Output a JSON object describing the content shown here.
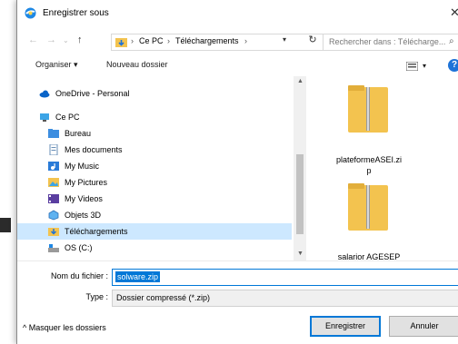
{
  "window": {
    "title": "Enregistrer sous"
  },
  "address": {
    "crumbs": [
      "Ce PC",
      "Téléchargements"
    ],
    "search_placeholder": "Rechercher dans : Télécharge..."
  },
  "toolbar": {
    "organize": "Organiser ▾",
    "new_folder": "Nouveau dossier"
  },
  "nav": {
    "items": [
      {
        "label": "OneDrive - Personal",
        "icon": "cloud-icon"
      },
      {
        "label": "Ce PC",
        "icon": "pc-icon"
      },
      {
        "label": "Bureau",
        "icon": "folder-icon"
      },
      {
        "label": "Mes documents",
        "icon": "documents-icon"
      },
      {
        "label": "My Music",
        "icon": "music-icon"
      },
      {
        "label": "My Pictures",
        "icon": "pictures-icon"
      },
      {
        "label": "My Videos",
        "icon": "videos-icon"
      },
      {
        "label": "Objets 3D",
        "icon": "objects3d-icon"
      },
      {
        "label": "Téléchargements",
        "icon": "downloads-icon",
        "selected": true
      },
      {
        "label": "OS (C:)",
        "icon": "drive-icon"
      }
    ]
  },
  "files": [
    {
      "name_line1": "plateformeASEI.zi",
      "name_line2": "p"
    },
    {
      "name_line1": "salarior AGESEP",
      "name_line2": ""
    }
  ],
  "form": {
    "filename_label": "Nom du fichier :",
    "filename_value": "solware.zip",
    "type_label": "Type :",
    "type_value": "Dossier compressé (*.zip)"
  },
  "footer": {
    "hide_folders": "^ Masquer les dossiers",
    "save": "Enregistrer",
    "cancel": "Annuler"
  },
  "colors": {
    "accent": "#0078d7",
    "selection": "#cde8ff",
    "folder": "#f3c34f"
  }
}
